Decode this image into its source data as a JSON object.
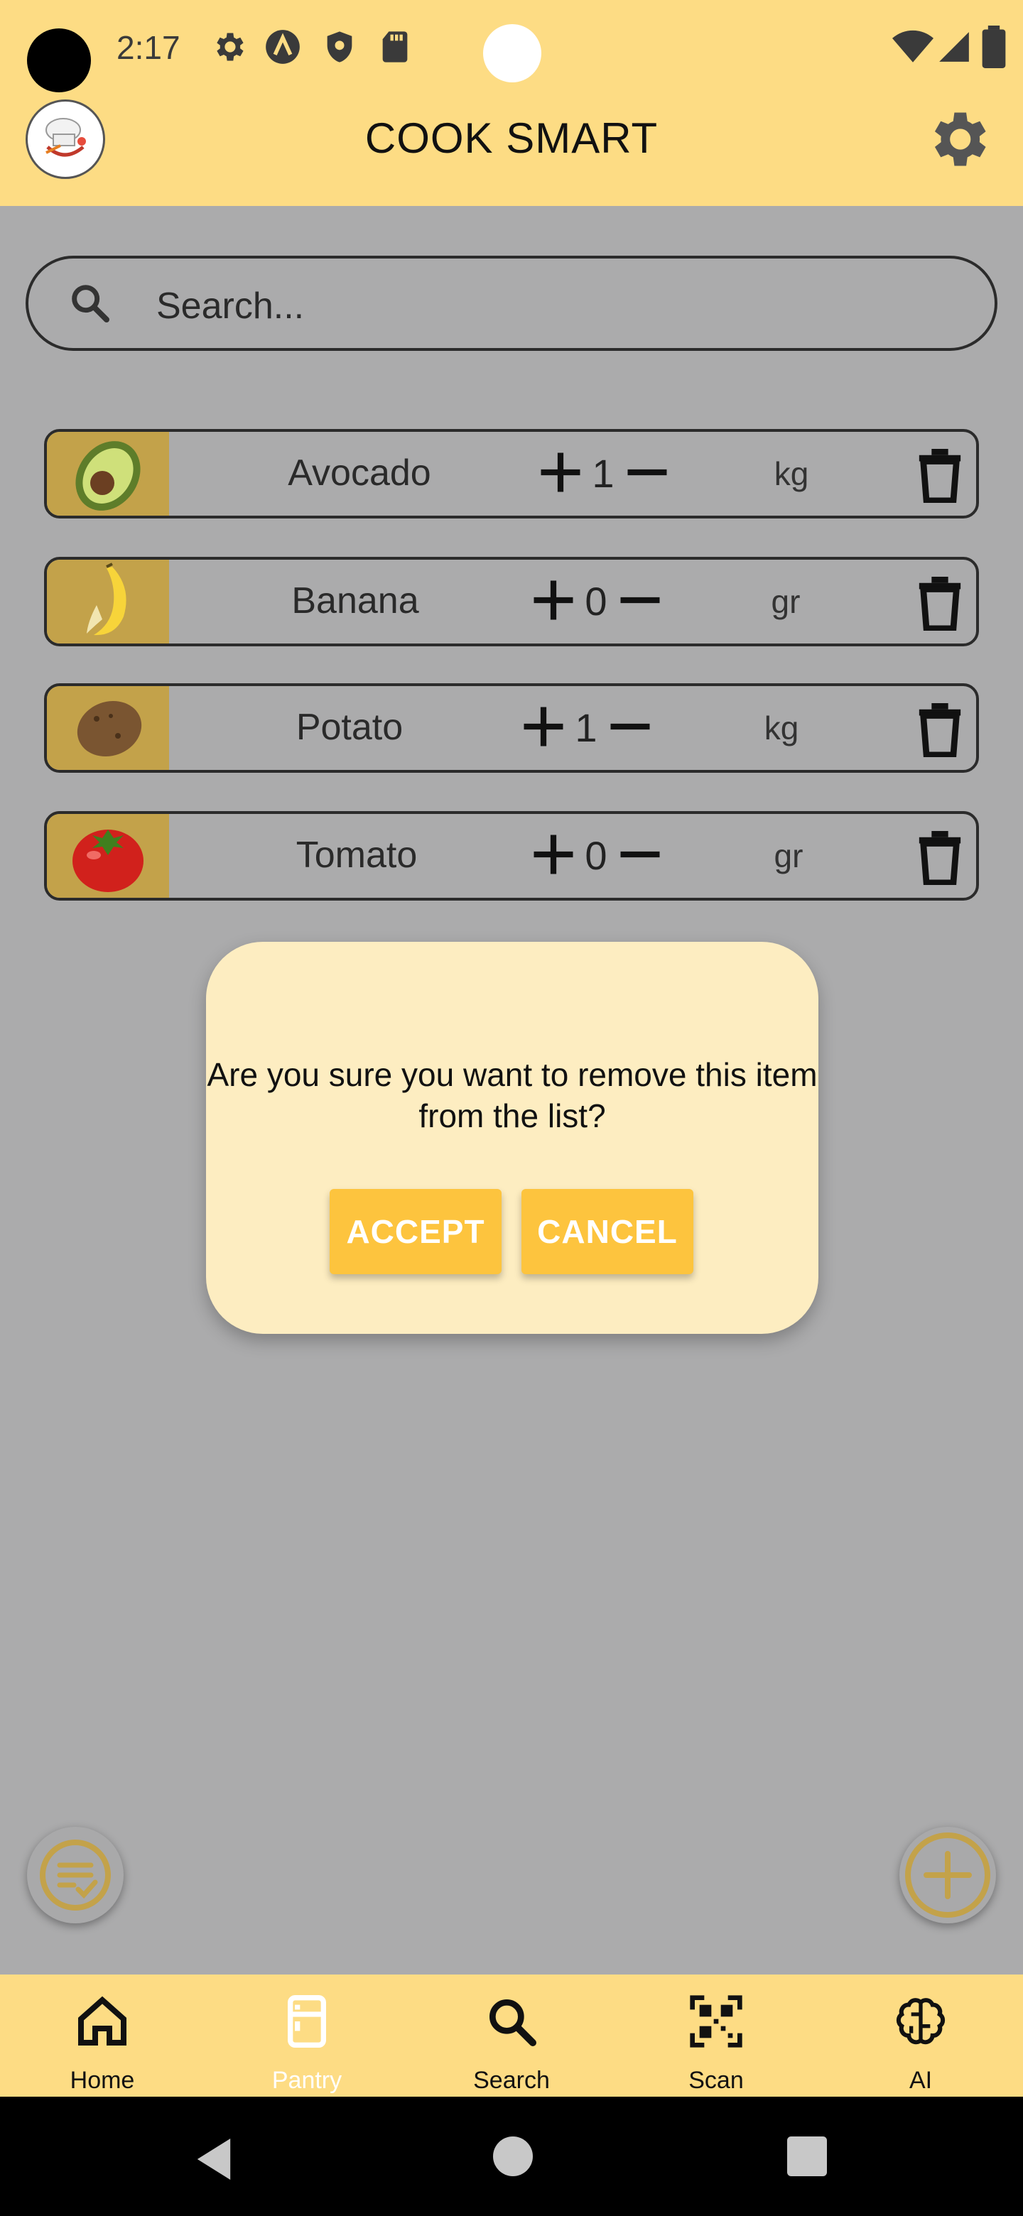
{
  "status_bar": {
    "time": "2:17"
  },
  "app_bar": {
    "title": "COOK SMART"
  },
  "search": {
    "placeholder": "Search..."
  },
  "pantry_items": [
    {
      "name": "Avocado",
      "quantity": "1",
      "unit": "kg"
    },
    {
      "name": "Banana",
      "quantity": "0",
      "unit": "gr"
    },
    {
      "name": "Potato",
      "quantity": "1",
      "unit": "kg"
    },
    {
      "name": "Tomato",
      "quantity": "0",
      "unit": "gr"
    }
  ],
  "dialog": {
    "message": "Are you sure you want to remove this item from the list?",
    "accept_label": "ACCEPT",
    "cancel_label": "CANCEL"
  },
  "bottom_nav": {
    "home": "Home",
    "pantry": "Pantry",
    "search": "Search",
    "scan": "Scan",
    "ai": "AI",
    "active": "pantry"
  },
  "colors": {
    "accent": "#fddc84",
    "dialog_bg": "#fdedc1",
    "button": "#fdc43e",
    "scrim_bg": "#ababac",
    "fab_icon": "#c3a24a"
  },
  "icons": [
    "gear-icon",
    "search-icon",
    "plus-icon",
    "minus-icon",
    "trash-icon",
    "home-icon",
    "fridge-icon",
    "qr-icon",
    "brain-icon",
    "checklist-icon",
    "add-icon"
  ]
}
